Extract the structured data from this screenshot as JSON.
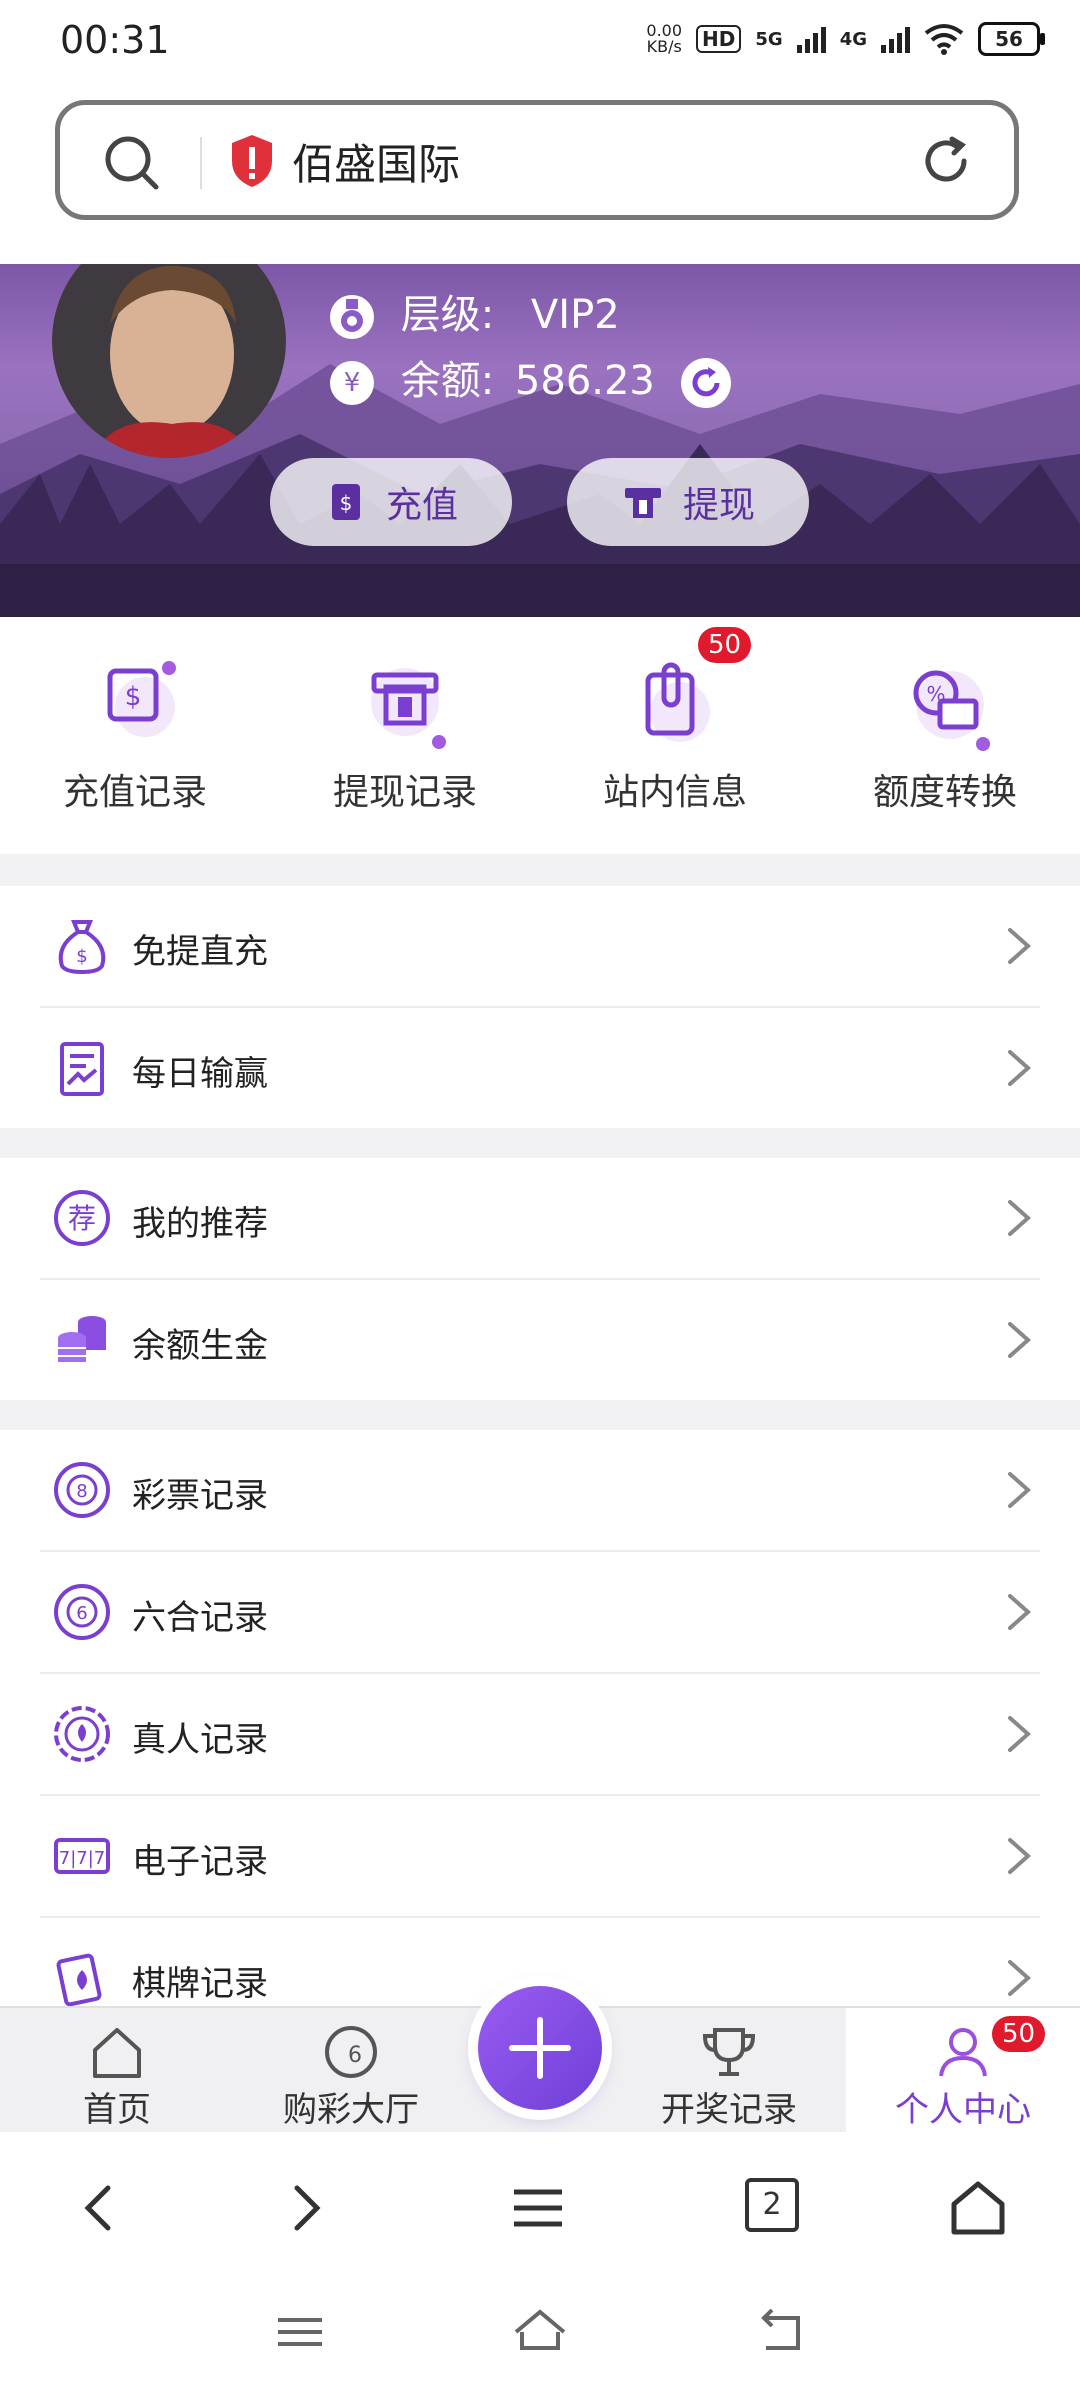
{
  "status_bar": {
    "time": "00:31",
    "net_speed": "0.00",
    "net_unit": "KB/s",
    "hd_label": "HD",
    "net1": "5G",
    "net2": "4G",
    "battery": "56"
  },
  "address_bar": {
    "site_name": "佰盛国际"
  },
  "profile": {
    "level_label": "层级:",
    "level_value": "VIP2",
    "balance_label": "余额:",
    "balance_value": "586.23",
    "yuan_symbol": "¥",
    "recharge_button": "充值",
    "withdraw_button": "提现"
  },
  "quick_actions": [
    {
      "label": "充值记录"
    },
    {
      "label": "提现记录"
    },
    {
      "label": "站内信息",
      "badge": "50"
    },
    {
      "label": "额度转换"
    }
  ],
  "menu_groups": {
    "group1": [
      {
        "label": "免提直充"
      },
      {
        "label": "每日输赢"
      }
    ],
    "group2": [
      {
        "label": "我的推荐",
        "icon_char": "荐"
      },
      {
        "label": "余额生金"
      }
    ],
    "group3": [
      {
        "label": "彩票记录",
        "icon_char": "8"
      },
      {
        "label": "六合记录",
        "icon_char": "6"
      },
      {
        "label": "真人记录"
      },
      {
        "label": "电子记录",
        "icon_char": "7|7|7"
      },
      {
        "label": "棋牌记录"
      }
    ]
  },
  "tab_bar": {
    "home": "首页",
    "lottery_hall": "购彩大厅",
    "draw_results": "开奖记录",
    "personal_center": "个人中心",
    "personal_badge": "50",
    "lottery_icon_char": "6"
  },
  "browser_nav": {
    "tab_count": "2"
  },
  "colors": {
    "accent": "#7a3fd0",
    "badge": "#e0192d"
  }
}
